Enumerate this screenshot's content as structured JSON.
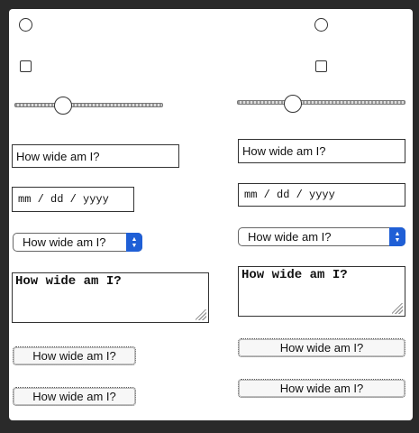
{
  "left_column": {
    "text_input_value": "How wide am I?",
    "date_placeholder": "mm / dd / yyyy",
    "select_value": "How wide am I?",
    "textarea_value": "How wide am I?",
    "button1_label": "How wide am I?",
    "button2_label": "How wide am I?"
  },
  "right_column": {
    "text_input_value": "How wide am I?",
    "date_placeholder": "mm / dd / yyyy",
    "select_value": "How wide am I?",
    "textarea_value": "How wide am I?",
    "button1_label": "How wide am I?",
    "button2_label": "How wide am I?"
  },
  "colors": {
    "background": "#2a2a2a",
    "panel": "#ffffff",
    "select_accent": "#1f5fd6"
  }
}
